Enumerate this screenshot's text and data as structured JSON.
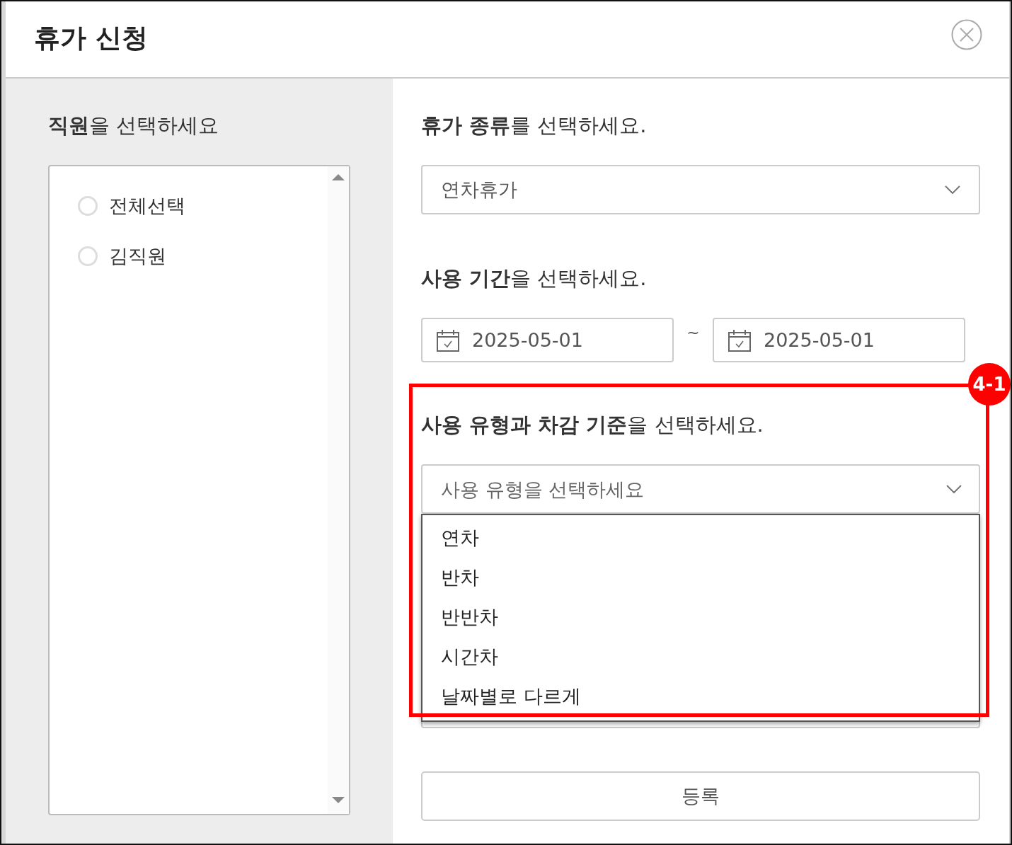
{
  "dialog": {
    "title": "휴가 신청"
  },
  "employee_panel": {
    "label": "**직원**을 선택하세요",
    "items": [
      {
        "label": "전체선택",
        "selected": false
      },
      {
        "label": "김직원",
        "selected": false
      }
    ]
  },
  "leave_type": {
    "label": "**휴가 종류**를 선택하세요.",
    "value": "연차휴가"
  },
  "period": {
    "label": "**사용 기간**을 선택하세요.",
    "start": "2025-05-01",
    "separator": "~",
    "end": "2025-05-01"
  },
  "usage": {
    "label": "**사용 유형과 차감 기준**을 선택하세요.",
    "placeholder": "사용 유형을 선택하세요",
    "expanded": true,
    "options": [
      "연차",
      "반차",
      "반반차",
      "시간차",
      "날짜별로 다르게"
    ]
  },
  "annotation": {
    "badge": "4-1"
  },
  "submit_button": "등록"
}
